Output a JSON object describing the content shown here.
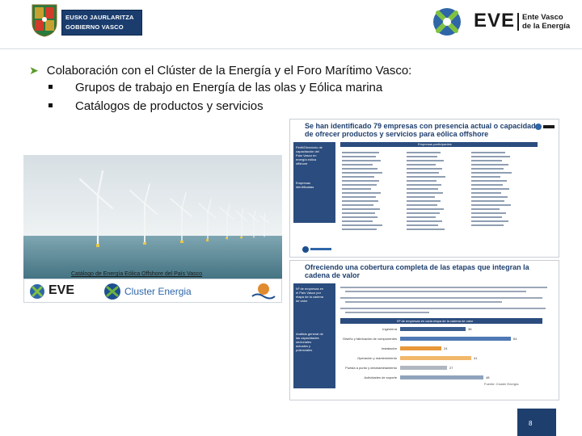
{
  "header": {
    "gv_logo_lines": [
      "EUSKO JAURLARITZA",
      "GOBIERNO VASCO"
    ],
    "eve_word": "EVE",
    "eve_name": "Ente Vasco\nde la Energía"
  },
  "content": {
    "heading": "Colaboración con el Clúster de la Energía y el Foro Marítimo Vasco:",
    "bullets": [
      "Grupos de trabajo en Energía de las olas y Eólica marina",
      "Catálogos de productos y servicios"
    ]
  },
  "cover": {
    "caption": "Catálogo de Energía Eólica Offshore del País Vasco",
    "eve_word": "EVE",
    "cluster_name": "Cluster Energia"
  },
  "report_page_1": {
    "title_line1": "Se han identificado 79 empresas con presencia actual o capacidad",
    "title_line2": "de ofrecer productos y servicios para eólica offshore",
    "side_text": "Perfil/Directorio de\ncapacitación del\nPaís Vasco en\nenergía eólica\noffshore",
    "side_text2": "Empresas\nidentificadas",
    "table_header": "Empresas participantes"
  },
  "report_page_2": {
    "title_line1": "Ofreciendo una cobertura completa de las etapas que integran la",
    "title_line2": "cadena de valor",
    "chart_title": "Nº de empresas en cada etapa de la cadena de valor",
    "side_text": "Nº de empresas en\nel País Vasco por\netapa de la cadena\nde valor",
    "side_text2": "Análisis general de\nlas capacidades\nsectoriales\nactuales y\npotenciales",
    "source": "Fuente: Cluster Energía"
  },
  "chart_data": {
    "type": "bar",
    "title": "Nº de empresas en cada etapa de la cadena de valor",
    "categories": [
      "Ingeniería",
      "Diseño y fabricación de componentes",
      "Instalación",
      "Operación y mantenimiento",
      "Puesta a punto y desmantelamiento",
      "Actividades de soporte"
    ],
    "values": [
      38,
      64,
      24,
      41,
      27,
      48
    ],
    "xlim": [
      0,
      70
    ],
    "colors": [
      "#3a5d8f",
      "#4f79b5",
      "#e8973a",
      "#f2b86a",
      "#b0b7c0",
      "#8fa3bd"
    ]
  },
  "footer": {
    "slide_number": "8"
  }
}
